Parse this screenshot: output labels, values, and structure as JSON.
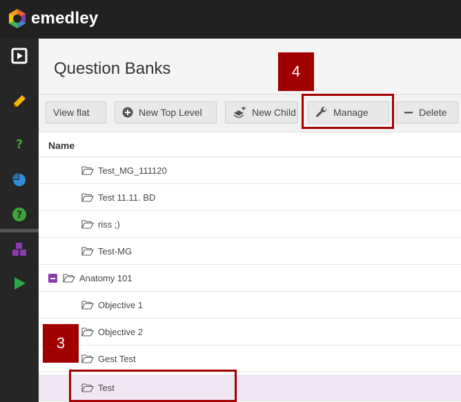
{
  "app": {
    "name": "emedley"
  },
  "page": {
    "title": "Question Banks"
  },
  "toolbar": {
    "view_flat": "View flat",
    "new_top_level": "New Top Level",
    "new_child": "New Child",
    "manage": "Manage",
    "delete": "Delete"
  },
  "table": {
    "column_name": "Name",
    "rows": [
      {
        "label": "Test_MG_111120",
        "level": 1
      },
      {
        "label": "Test 11.11. BD",
        "level": 1
      },
      {
        "label": "riss ;)",
        "level": 1
      },
      {
        "label": "Test-MG",
        "level": 1
      },
      {
        "label": "Anatomy 101",
        "level": 0,
        "expanded": true
      },
      {
        "label": "Objective 1",
        "level": 1
      },
      {
        "label": "Objective 2",
        "level": 1
      },
      {
        "label": "Gest Test",
        "level": 1
      },
      {
        "label": "Test",
        "level": 1,
        "selected": true
      }
    ]
  },
  "sidebar": {
    "icons": [
      "play-box-icon",
      "pencil-icon",
      "question-mark-icon",
      "pie-chart-icon",
      "help-circle-icon",
      "cubes-icon",
      "play-triangle-icon"
    ]
  },
  "annotations": {
    "step_3": "3",
    "step_4": "4"
  },
  "colors": {
    "accent": "#8a3bb0",
    "callout": "#a10000",
    "selected_row": "#f1e6f3"
  }
}
